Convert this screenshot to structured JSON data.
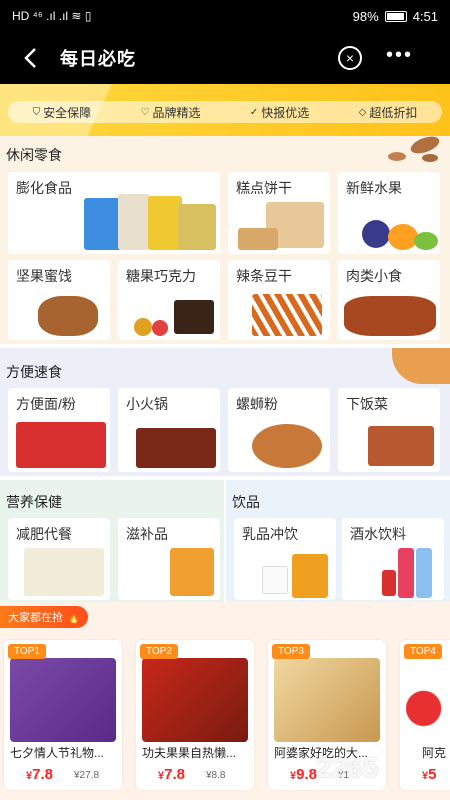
{
  "status": {
    "left": "HD ⁴⁶ .ıl .ıl ≋ ▯",
    "battery": "98%",
    "time": "4:51"
  },
  "nav": {
    "title": "每日必吃",
    "back": "‹",
    "close": "×",
    "more": "•••"
  },
  "badges": [
    "安全保障",
    "品牌精选",
    "快报优选",
    "超低折扣"
  ],
  "sections": {
    "snacks": {
      "title": "休闲零食",
      "items": [
        "膨化食品",
        "糕点饼干",
        "新鲜水果",
        "坚果蜜饯",
        "糖果巧克力",
        "辣条豆干",
        "肉类小食"
      ]
    },
    "instant": {
      "title": "方便速食",
      "items": [
        "方便面/粉",
        "小火锅",
        "螺蛳粉",
        "下饭菜"
      ]
    },
    "health": {
      "title": "营养保健",
      "items": [
        "减肥代餐",
        "滋补品"
      ]
    },
    "drinks": {
      "title": "饮品",
      "items": [
        "乳品冲饮",
        "酒水饮料"
      ]
    }
  },
  "hot": {
    "label": "大家都在抢",
    "icon": "fire-icon"
  },
  "products": [
    {
      "rank": "TOP1",
      "name": "七夕情人节礼物...",
      "price_sym": "¥",
      "price": "7.8",
      "orig": "¥27.8"
    },
    {
      "rank": "TOP2",
      "name": "功夫果果自热懒...",
      "price_sym": "¥",
      "price": "7.8",
      "orig": "¥8.8"
    },
    {
      "rank": "TOP3",
      "name": "阿婆家好吃的大...",
      "price_sym": "¥",
      "price": "9.8",
      "orig": "¥1"
    },
    {
      "rank": "TOP4",
      "name": "阿克",
      "price_sym": "¥",
      "price": "5",
      "orig": ""
    }
  ],
  "watermark": {
    "main": "2265",
    "sub": "手游网"
  },
  "colors": {
    "accent": "#ffc21a",
    "price": "#ff2222",
    "tag": "#ff8c1a"
  }
}
